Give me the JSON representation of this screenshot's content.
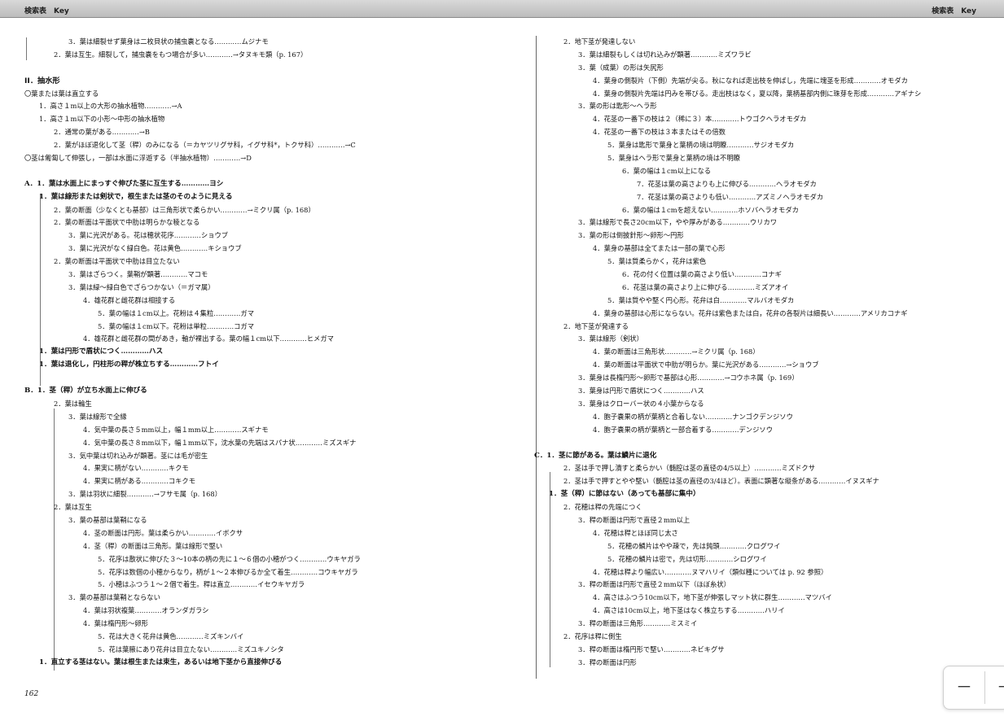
{
  "header": {
    "left": "検索表　Key",
    "right": "検索表　Key"
  },
  "page_number": "162",
  "zoom_controls": {
    "zoom_out": "－",
    "zoom_in": "＋"
  },
  "left_column": [
    {
      "t": "3．葉は細裂せず葉身は二枚貝状の捕虫嚢となる…………ムジナモ",
      "i": 3
    },
    {
      "t": "2．葉は互生。細裂して，捕虫嚢をもつ場合が多い…………→タヌキモ類（p. 167）",
      "i": 2
    },
    {
      "t": "",
      "i": 0
    },
    {
      "t": "II．抽水形",
      "i": 0,
      "s": "h"
    },
    {
      "t": "〇葉または葉は直立する",
      "i": 0
    },
    {
      "t": "1．高さ１m以上の大形の抽水植物…………→A",
      "i": 1
    },
    {
      "t": "1．高さ１m以下の小形～中形の抽水植物",
      "i": 1
    },
    {
      "t": "2．通常の葉がある…………→B",
      "i": 2
    },
    {
      "t": "2．葉がほぼ退化して茎（稈）のみになる（＝カヤツリグサ科，イグサ科*，トクサ科）…………→C",
      "i": 2
    },
    {
      "t": "〇茎は匍匐して伸張し，一部は水面に浮遊する（半抽水植物）…………→D",
      "i": 0
    },
    {
      "t": "",
      "i": 0
    },
    {
      "t": "A．1．葉は水面上にまっすぐ伸びた茎に互生する…………ヨシ",
      "i": 0,
      "s": "b"
    },
    {
      "t": "1．葉は線形または剣状で，根生または茎のそのように見える",
      "i": 1,
      "s": "b"
    },
    {
      "t": "2．葉の断面（少なくとも基部）は三角形状で柔らかい…………→ミクリ属（p. 168）",
      "i": 2
    },
    {
      "t": "2．葉の断面は平面状で中肋は明らかな稜となる",
      "i": 2
    },
    {
      "t": "3．葉に光沢がある。花は穂状花序…………ショウブ",
      "i": 3
    },
    {
      "t": "3．葉に光沢がなく緑白色。花は黄色…………キショウブ",
      "i": 3
    },
    {
      "t": "2．葉の断面は平面状で中肋は目立たない",
      "i": 2
    },
    {
      "t": "3．葉はざらつく。葉鞘が顕著…………マコモ",
      "i": 3
    },
    {
      "t": "3．葉は緑～緑白色でざらつかない（＝ガマ属）",
      "i": 3
    },
    {
      "t": "4．雄花群と雌花群は相接する",
      "i": 4
    },
    {
      "t": "5．葉の幅は１cm以上。花粉は４集粒…………ガマ",
      "i": 5
    },
    {
      "t": "5．葉の幅は１cm以下。花粉は単粒…………コガマ",
      "i": 5
    },
    {
      "t": "4．雄花群と雌花群の間があき，軸が裸出する。葉の幅１cm以下…………ヒメガマ",
      "i": 4
    },
    {
      "t": "1．葉は円形で盾状につく…………ハス",
      "i": 1,
      "s": "b"
    },
    {
      "t": "1．葉は退化し，円柱形の稈が株立ちする…………フトイ",
      "i": 1,
      "s": "b"
    },
    {
      "t": "",
      "i": 0
    },
    {
      "t": "B．1．茎（稈）が立ち水面上に伸びる",
      "i": 0,
      "s": "b"
    },
    {
      "t": "2．葉は輪生",
      "i": 2
    },
    {
      "t": "3．葉は線形で全縁",
      "i": 3
    },
    {
      "t": "4．気中葉の長さ５mm以上，幅１mm以上…………スギナモ",
      "i": 4
    },
    {
      "t": "4．気中葉の長さ８mm以下，幅１mm以下，沈水葉の先端はスパナ状…………ミズスギナ",
      "i": 4
    },
    {
      "t": "3．気中葉は切れ込みが顕著。茎には毛が密生",
      "i": 3
    },
    {
      "t": "4．果実に柄がない…………キクモ",
      "i": 4
    },
    {
      "t": "4．果実に柄がある…………コキクモ",
      "i": 4
    },
    {
      "t": "3．葉は羽状に細裂…………→フサモ属（p. 168）",
      "i": 3
    },
    {
      "t": "2．葉は互生",
      "i": 2
    },
    {
      "t": "3．葉の基部は葉鞘になる",
      "i": 3
    },
    {
      "t": "4．茎の断面は円形。葉は柔らかい…………イボクサ",
      "i": 4
    },
    {
      "t": "4．茎（稈）の断面は三角形。葉は線形で堅い",
      "i": 4
    },
    {
      "t": "5．花序は散状に伸びた３～10本の柄の先に１～６個の小穂がつく…………ウキヤガラ",
      "i": 5
    },
    {
      "t": "5．花序は数個の小穂からなり，柄が１～２本伸びるか全て着生…………コウキヤガラ",
      "i": 5
    },
    {
      "t": "5．小穂はふつう１～２個で着生。稈は直立…………イセウキヤガラ",
      "i": 5
    },
    {
      "t": "3．葉の基部は葉鞘とならない",
      "i": 3
    },
    {
      "t": "4．葉は羽状複葉…………オランダガラシ",
      "i": 4
    },
    {
      "t": "4．葉は楕円形～卵形",
      "i": 4
    },
    {
      "t": "5．花は大きく花弁は黄色…………ミズキンバイ",
      "i": 5
    },
    {
      "t": "5．花は葉腋にあり花弁は目立たない…………ミズユキノシタ",
      "i": 5
    },
    {
      "t": "1．直立する茎はない。葉は根生または束生，あるいは地下茎から直接伸びる",
      "i": 1,
      "s": "b"
    }
  ],
  "right_column": [
    {
      "t": "2．地下茎が発達しない",
      "i": 2
    },
    {
      "t": "3．葉は細裂もしくは切れ込みが顕著…………ミズワラビ",
      "i": 3
    },
    {
      "t": "3．葉（成葉）の形は矢尻形",
      "i": 3
    },
    {
      "t": "4．葉身の側裂片（下側）先端が尖る。秋になれば走出枝を伸ばし，先端に塊茎を形成…………オモダカ",
      "i": 4
    },
    {
      "t": "4．葉身の側裂片先端は円みを帯びる。走出枝はなく，夏以降，葉柄基部内側に珠芽を形成…………アギナシ",
      "i": 4
    },
    {
      "t": "3．葉の形は匙形～ヘラ形",
      "i": 3
    },
    {
      "t": "4．花茎の一番下の枝は２（稀に３）本…………トウゴクヘラオモダカ",
      "i": 4
    },
    {
      "t": "4．花茎の一番下の枝は３本またはその倍数",
      "i": 4
    },
    {
      "t": "5．葉身は匙形で葉身と葉柄の境は明瞭…………サジオモダカ",
      "i": 5
    },
    {
      "t": "5．葉身はヘラ形で葉身と葉柄の境は不明瞭",
      "i": 5
    },
    {
      "t": "6．葉の幅は１cm以上になる",
      "i": 6
    },
    {
      "t": "7．花茎は葉の高さよりも上に伸びる…………ヘラオモダカ",
      "i": 7
    },
    {
      "t": "7．花茎は葉の高さよりも低い…………アズミノヘラオモダカ",
      "i": 7
    },
    {
      "t": "6．葉の幅は１cmを超えない…………ホソバヘラオモダカ",
      "i": 6
    },
    {
      "t": "3．葉は線形で長さ20cm以下，やや厚みがある…………ウリカワ",
      "i": 3
    },
    {
      "t": "3．葉の形は倒披針形～卵形～円形",
      "i": 3
    },
    {
      "t": "4．葉身の基部は全てまたは一部の葉で心形",
      "i": 4
    },
    {
      "t": "5．葉は質柔らかく，花弁は紫色",
      "i": 5
    },
    {
      "t": "6．花の付く位置は葉の高さより低い…………コナギ",
      "i": 6
    },
    {
      "t": "6．花茎は葉の高さより上に伸びる…………ミズアオイ",
      "i": 6
    },
    {
      "t": "5．葉は質やや堅く円心形。花弁は白…………マルバオモダカ",
      "i": 5
    },
    {
      "t": "4．葉身の基部は心形にならない。花弁は紫色または白，花弁の各裂片は細長い…………アメリカコナギ",
      "i": 4
    },
    {
      "t": "2．地下茎が発達する",
      "i": 2
    },
    {
      "t": "3．葉は線形（剣状）",
      "i": 3
    },
    {
      "t": "4．葉の断面は三角形状…………→ミクリ属（p. 168）",
      "i": 4
    },
    {
      "t": "4．葉の断面は平面状で中肋が明らか。葉に光沢がある…………→ショウブ",
      "i": 4
    },
    {
      "t": "3．葉身は長楕円形～卵形で基部は心形…………→コウホネ属（p. 169）",
      "i": 3
    },
    {
      "t": "3．葉身は円形で盾状につく…………ハス",
      "i": 3
    },
    {
      "t": "3．葉身はクローバー状の４小葉からなる",
      "i": 3
    },
    {
      "t": "4．胞子嚢果の柄が葉柄と合着しない…………ナンゴクデンジソウ",
      "i": 4
    },
    {
      "t": "4．胞子嚢果の柄が葉柄と一部合着する…………デンジソウ",
      "i": 4
    },
    {
      "t": "",
      "i": 0
    },
    {
      "t": "C．1．茎に節がある。葉は鱗片に退化",
      "i": 0,
      "s": "b"
    },
    {
      "t": "2．茎は手で押し潰すと柔らかい（髄腔は茎の直径の4/5以上）…………ミズドクサ",
      "i": 2
    },
    {
      "t": "2．茎は手で押すとやや堅い（髄腔は茎の直径の3/4ほど）。表面に顕著な縦条がある…………イヌスギナ",
      "i": 2
    },
    {
      "t": "1．茎（稈）に節はない（あっても基部に集中）",
      "i": 1,
      "s": "b"
    },
    {
      "t": "2．花穂は稈の先端につく",
      "i": 2
    },
    {
      "t": "3．稈の断面は円形で直径２mm以上",
      "i": 3
    },
    {
      "t": "4．花穂は稈とほぼ同じ太さ",
      "i": 4
    },
    {
      "t": "5．花穂の鱗片はやや疎で，先は鈍頭…………クログワイ",
      "i": 5
    },
    {
      "t": "5．花穂の鱗片は密で，先は切形…………シログワイ",
      "i": 5
    },
    {
      "t": "4．花穂は稈より幅広い…………ヌマハリイ（類似種については p. 92 参照）",
      "i": 4
    },
    {
      "t": "3．稈の断面は円形で直径２mm以下（ほぼ糸状）",
      "i": 3
    },
    {
      "t": "4．高さはふつう10cm以下，地下茎が伸張しマット状に群生…………マツバイ",
      "i": 4
    },
    {
      "t": "4．高さは10cm以上，地下茎はなく株立ちする…………ハリイ",
      "i": 4
    },
    {
      "t": "3．稈の断面は三角形…………ミスミイ",
      "i": 3
    },
    {
      "t": "2．花序は稈に側生",
      "i": 2
    },
    {
      "t": "3．稈の断面は楕円形で堅い…………ネビキグサ",
      "i": 3
    },
    {
      "t": "3．稈の断面は円形",
      "i": 3
    }
  ]
}
